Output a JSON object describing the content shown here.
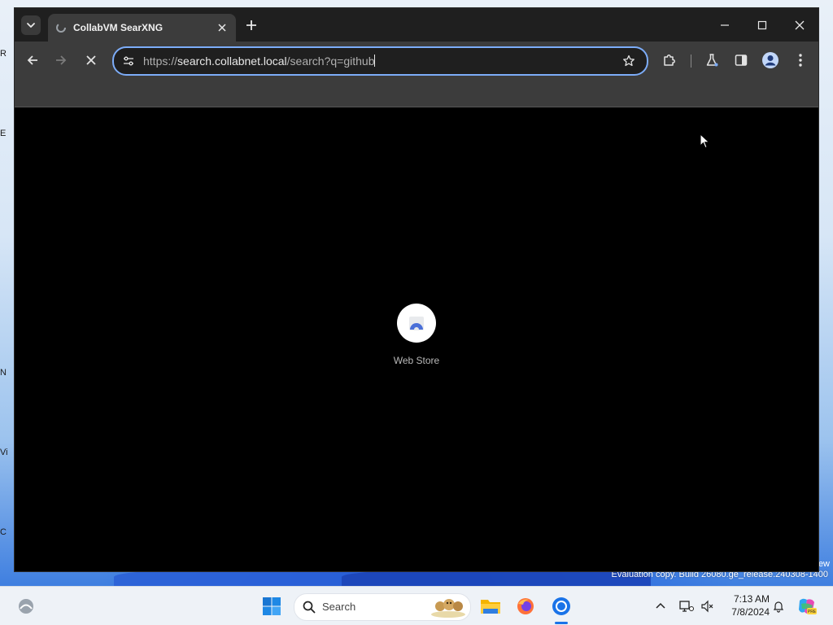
{
  "browser": {
    "tab": {
      "title": "CollabVM SearXNG"
    },
    "omnibox": {
      "url_scheme": "https://",
      "url_host": "search.collabnet.local",
      "url_path": "/search?q=github"
    },
    "new_tab_page": {
      "shortcuts": [
        {
          "label": "Web Store"
        }
      ]
    }
  },
  "desktop": {
    "edge_letters": [
      "R",
      "E",
      "N",
      "Vi",
      "C"
    ],
    "watermark": "Evaluation copy. Build 26080.ge_release.240308-1400",
    "watermark_edge": "ew"
  },
  "taskbar": {
    "search_label": "Search",
    "clock": {
      "time": "7:13 AM",
      "date": "7/8/2024"
    }
  },
  "colors": {
    "omnibox_focus": "#7cacf8",
    "toolbar_bg": "#3c3c3c",
    "tabstrip_bg": "#1f1f1f",
    "taskbar_bg": "#eef2f7",
    "accent_blue": "#1a73e8"
  }
}
